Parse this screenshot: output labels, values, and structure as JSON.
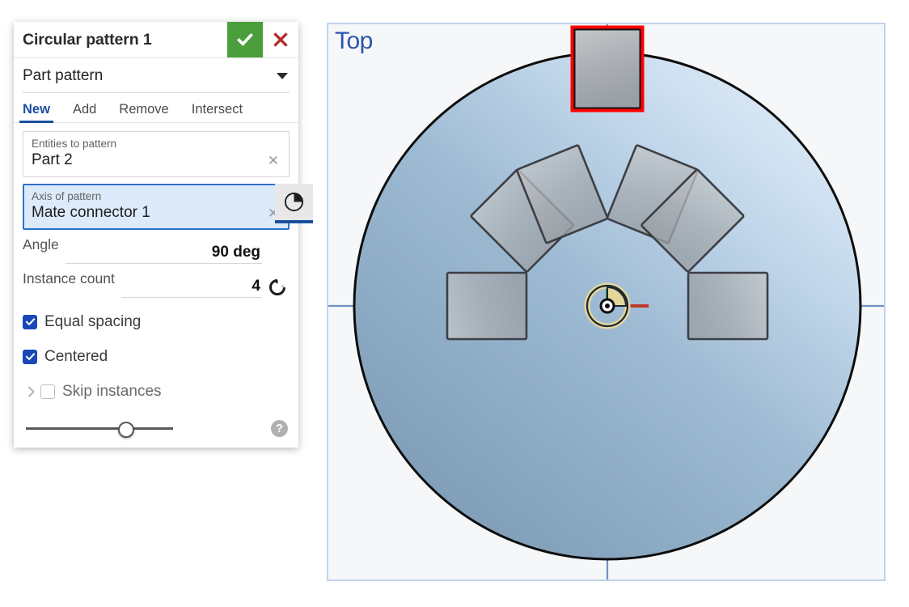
{
  "dialog": {
    "title": "Circular pattern 1",
    "accept_icon": "check-icon",
    "cancel_icon": "close-icon",
    "feature_type": "Part pattern",
    "dropdown_icon": "chevron-down-icon",
    "tabs": [
      {
        "label": "New",
        "active": true
      },
      {
        "label": "Add",
        "active": false
      },
      {
        "label": "Remove",
        "active": false
      },
      {
        "label": "Intersect",
        "active": false
      }
    ],
    "entities_field": {
      "caption": "Entities to pattern",
      "value": "Part 2",
      "clear_icon": "close-x-icon"
    },
    "axis_field": {
      "caption": "Axis of pattern",
      "value": "Mate connector 1",
      "clear_icon": "close-x-icon",
      "tool_icon": "pattern-axis-pie-icon",
      "selected": true
    },
    "angle": {
      "label": "Angle",
      "value": "90 deg"
    },
    "instance_count": {
      "label": "Instance count",
      "value": "4",
      "flip_icon": "flip-direction-icon"
    },
    "equal_spacing": {
      "label": "Equal spacing",
      "checked": true
    },
    "centered": {
      "label": "Centered",
      "checked": true
    },
    "skip_instances": {
      "label": "Skip instances",
      "checked": false,
      "expand_icon": "chevron-right-icon"
    },
    "footer": {
      "slider_position_pct": 62,
      "help_icon": "help-icon",
      "help_glyph": "?"
    }
  },
  "viewport": {
    "view_label": "Top",
    "colors": {
      "disc_fill_light": "#cfe0ef",
      "disc_fill_dark": "#7e9cb6",
      "disc_outline": "#0d0d0d",
      "part_fill": "#9aa1a8",
      "part_outline": "#3c3f44",
      "highlight": "#ff0000",
      "axis_x": "#c0392b",
      "axis_y": "#2e9e45",
      "mate_connector": "#e4d79a",
      "sketch_line": "#6f93c4",
      "viewport_border": "#c2d3ea",
      "accept_green": "#4a9f3c",
      "cancel_red": "#b52b2b",
      "accent_blue": "#1a4fa0"
    },
    "parts": [
      {
        "name": "instance-top-highlighted",
        "angle_deg": 0,
        "highlighted": true
      },
      {
        "name": "instance-ne-45",
        "angle_deg": 45,
        "highlighted": false
      },
      {
        "name": "instance-east",
        "angle_deg": 90,
        "highlighted": false
      },
      {
        "name": "instance-se-135",
        "angle_deg": 135,
        "highlighted": false
      },
      {
        "name": "instance-nw-315",
        "angle_deg": 315,
        "highlighted": false
      },
      {
        "name": "instance-west",
        "angle_deg": 270,
        "highlighted": false
      },
      {
        "name": "instance-sw-225",
        "angle_deg": 225,
        "highlighted": false
      }
    ],
    "mate_connector": {
      "name": "mate-connector-origin",
      "x_axis_color": "#c0392b",
      "y_axis_color": "#2e9e45"
    }
  }
}
